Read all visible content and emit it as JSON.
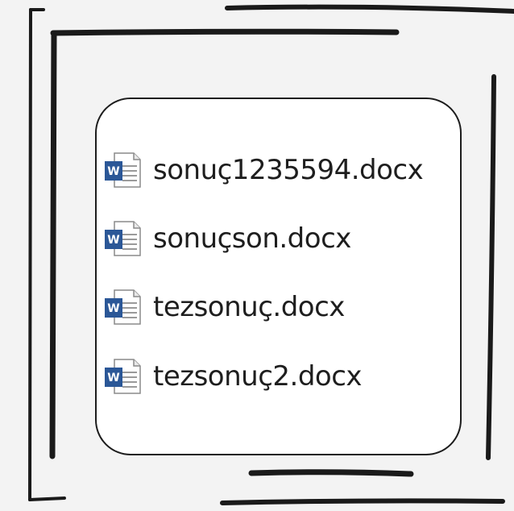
{
  "files": [
    {
      "name": "sonuç1235594.docx",
      "icon": "word-document-icon"
    },
    {
      "name": "sonuçson.docx",
      "icon": "word-document-icon"
    },
    {
      "name": "tezsonuç.docx",
      "icon": "word-document-icon"
    },
    {
      "name": "tezsonuç2.docx",
      "icon": "word-document-icon"
    }
  ],
  "colors": {
    "background": "#f3f3f3",
    "panel": "#ffffff",
    "stroke": "#1c1c1c",
    "word_blue": "#2b5797",
    "text": "#1e1e1e"
  }
}
